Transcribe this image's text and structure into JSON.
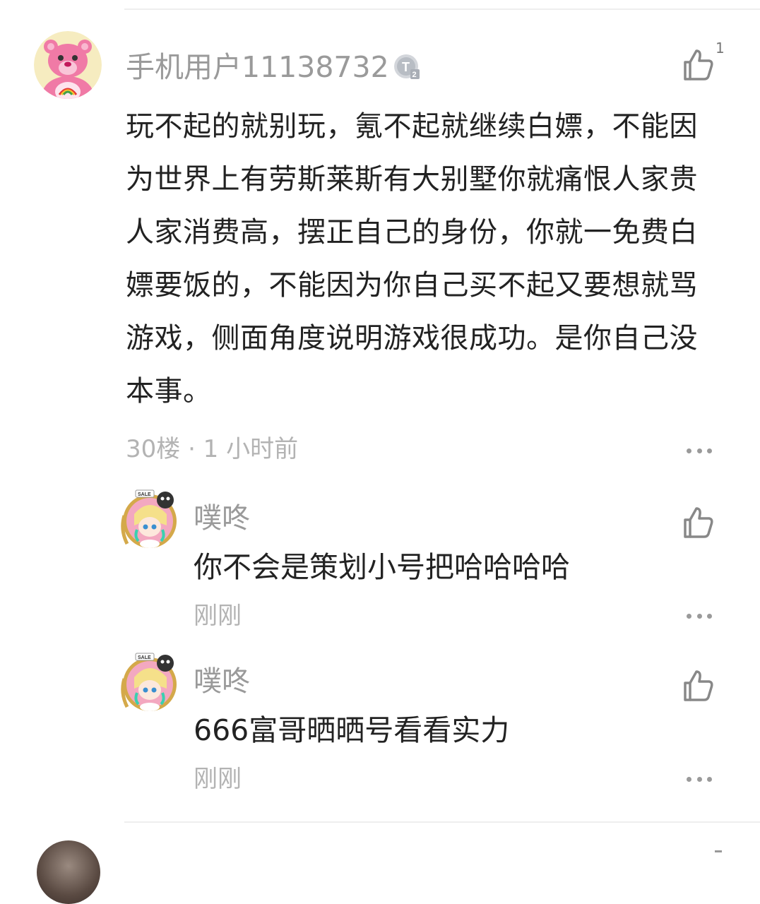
{
  "main_comment": {
    "username": "手机用户11138732",
    "level_badge": "T2",
    "like_count": "1",
    "content": "玩不起的就别玩，氪不起就继续白嫖，不能因为世界上有劳斯莱斯有大别墅你就痛恨人家贵人家消费高，摆正自己的身份，你就一免费白嫖要饭的，不能因为你自己买不起又要想就骂游戏，侧面角度说明游戏很成功。是你自己没本事。",
    "meta": "30楼 · 1 小时前",
    "avatar_icon": "pink-care-bear-avatar"
  },
  "replies": [
    {
      "username": "噗咚",
      "content": "你不会是策划小号把哈哈哈哈",
      "time": "刚刚",
      "avatar_icon": "anime-girl-avatar-with-sale-frame"
    },
    {
      "username": "噗咚",
      "content": "666富哥晒晒号看看实力",
      "time": "刚刚",
      "avatar_icon": "anime-girl-avatar-with-sale-frame"
    }
  ],
  "colors": {
    "username": "#9a9a9a",
    "body_text": "#222222",
    "meta_text": "#b3b3b3",
    "icon": "#888888",
    "divider": "#eeeeee"
  }
}
